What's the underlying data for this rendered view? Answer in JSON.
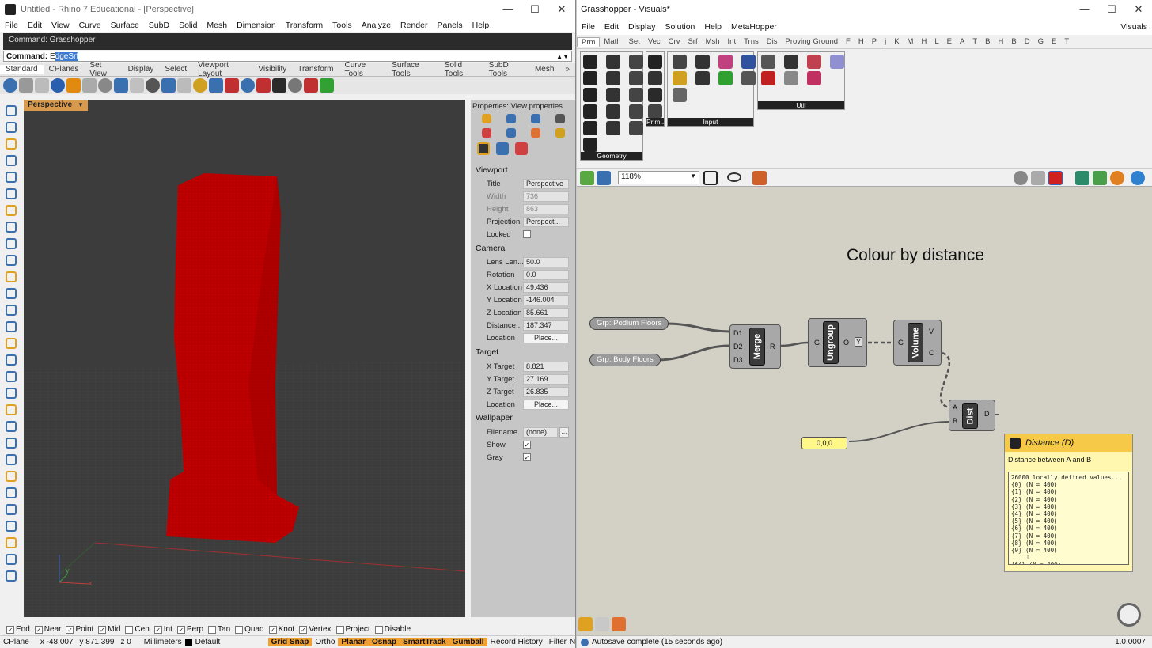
{
  "rhino": {
    "title": "Untitled - Rhino 7 Educational - [Perspective]",
    "menu": [
      "File",
      "Edit",
      "View",
      "Curve",
      "Surface",
      "SubD",
      "Solid",
      "Mesh",
      "Dimension",
      "Transform",
      "Tools",
      "Analyze",
      "Render",
      "Panels",
      "Help"
    ],
    "command_history": "Command: Grasshopper",
    "command_prefix": "Command: ",
    "command_first": "E",
    "command_selected": "dgeSrf",
    "toolbar_tabs": [
      "Standard",
      "CPlanes",
      "Set View",
      "Display",
      "Select",
      "Viewport Layout",
      "Visibility",
      "Transform",
      "Curve Tools",
      "Surface Tools",
      "Solid Tools",
      "SubD Tools",
      "Mesh"
    ],
    "viewport_label": "Perspective",
    "axis_x": "x",
    "axis_y": "y",
    "properties": {
      "header": "Properties: View properties",
      "section_viewport": "Viewport",
      "title_label": "Title",
      "title_value": "Perspective",
      "width_label": "Width",
      "width_value": "736",
      "height_label": "Height",
      "height_value": "863",
      "projection_label": "Projection",
      "projection_value": "Perspect...",
      "locked_label": "Locked",
      "section_camera": "Camera",
      "lens_label": "Lens Len...",
      "lens_value": "50.0",
      "rotation_label": "Rotation",
      "rotation_value": "0.0",
      "xloc_label": "X Location",
      "xloc_value": "49.436",
      "yloc_label": "Y Location",
      "yloc_value": "-146.004",
      "zloc_label": "Z Location",
      "zloc_value": "85.661",
      "distance_label": "Distance...",
      "distance_value": "187.347",
      "location_label": "Location",
      "place_button": "Place...",
      "section_target": "Target",
      "xtarget_label": "X Target",
      "xtarget_value": "8.821",
      "ytarget_label": "Y Target",
      "ytarget_value": "27.169",
      "ztarget_label": "Z Target",
      "ztarget_value": "26.835",
      "tlocation_label": "Location",
      "tplace_button": "Place...",
      "section_wallpaper": "Wallpaper",
      "filename_label": "Filename",
      "filename_value": "(none)",
      "browse_button": "...",
      "show_label": "Show",
      "gray_label": "Gray"
    },
    "osnaps": [
      {
        "label": "End",
        "checked": true
      },
      {
        "label": "Near",
        "checked": true
      },
      {
        "label": "Point",
        "checked": true
      },
      {
        "label": "Mid",
        "checked": true
      },
      {
        "label": "Cen",
        "checked": false
      },
      {
        "label": "Int",
        "checked": true
      },
      {
        "label": "Perp",
        "checked": true
      },
      {
        "label": "Tan",
        "checked": false
      },
      {
        "label": "Quad",
        "checked": false
      },
      {
        "label": "Knot",
        "checked": true
      },
      {
        "label": "Vertex",
        "checked": true
      },
      {
        "label": "Project",
        "checked": false
      },
      {
        "label": "Disable",
        "checked": false
      }
    ],
    "status": {
      "cplane": "CPlane",
      "x": "x -48.007",
      "y": "y 871.399",
      "z": "z 0",
      "units": "Millimeters",
      "layer": "Default",
      "grid_snap": "Grid Snap",
      "ortho": "Ortho",
      "planar": "Planar",
      "osnap": "Osnap",
      "smarttrack": "SmartTrack",
      "gumball": "Gumball",
      "record_history": "Record History",
      "filter": "Filter",
      "filter_tail": "N"
    }
  },
  "grasshopper": {
    "title": "Grasshopper - Visuals*",
    "menu": [
      "File",
      "Edit",
      "Display",
      "Solution",
      "Help",
      "MetaHopper"
    ],
    "doc_name": "Visuals",
    "tabs": [
      "Prm",
      "Math",
      "Set",
      "Vec",
      "Crv",
      "Srf",
      "Msh",
      "Int",
      "Trns",
      "Dis",
      "Proving Ground",
      "F",
      "H",
      "P",
      "j",
      "K",
      "M",
      "H",
      "L",
      "E",
      "A",
      "T",
      "B",
      "H",
      "B",
      "D",
      "G",
      "E",
      "T"
    ],
    "panel_geometry": "Geometry",
    "panel_prim": "Prim...",
    "panel_input": "Input",
    "panel_util": "Util",
    "zoom": "118%",
    "canvas_title": "Colour by distance",
    "nodes": {
      "podium": "Grp: Podium Floors",
      "body": "Grp: Body Floors",
      "merge": "Merge",
      "merge_d1": "D1",
      "merge_d2": "D2",
      "merge_d3": "D3",
      "merge_r": "R",
      "ungroup": "Ungroup",
      "ungroup_g": "G",
      "ungroup_o": "O",
      "ungroup_y": "Y",
      "volume": "Volume",
      "volume_g": "G",
      "volume_v": "V",
      "volume_c": "C",
      "dist": "Dist",
      "dist_a": "A",
      "dist_b": "B",
      "dist_d": "D",
      "point": "0,0,0"
    },
    "tooltip": {
      "title": "Distance (D)",
      "subtitle": "Distance between A and B",
      "header": "26000 locally defined values...",
      "rows": [
        "{0} (N = 400)",
        "{1} (N = 400)",
        "{2} (N = 400)",
        "{3} (N = 400)",
        "{4} (N = 400)",
        "{5} (N = 400)",
        "{6} (N = 400)",
        "{7} (N = 400)",
        "{8} (N = 400)",
        "{9} (N = 400)"
      ],
      "ellipsis": "⁞",
      "last": "{64} (N = 400)"
    },
    "status": "Autosave complete (15 seconds ago)",
    "version": "1.0.0007"
  },
  "colors": {
    "tower_red": "#c00000",
    "viewport_bg": "#3c3c3c",
    "canvas_bg": "#d3d0c6",
    "status_on": "#f0a030"
  }
}
